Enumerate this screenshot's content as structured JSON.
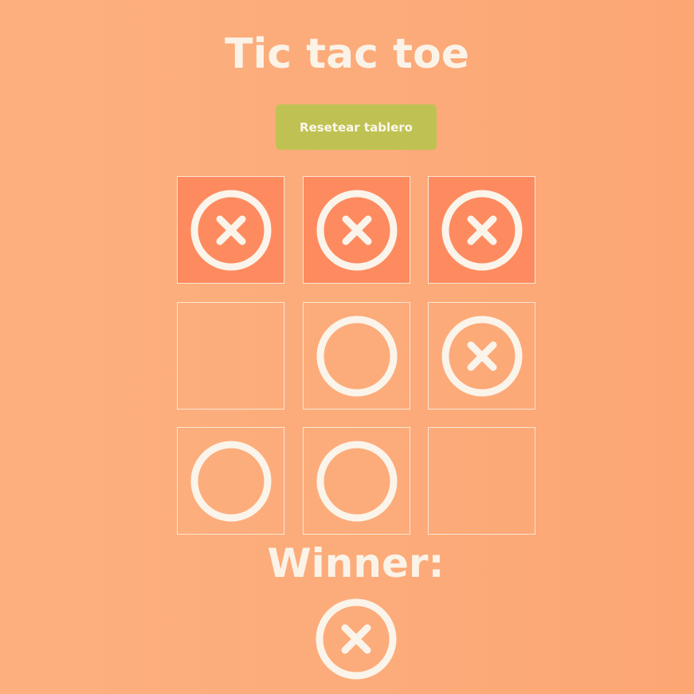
{
  "header": {
    "title": "Tic tac toe",
    "reset_label": "Resetear tablero"
  },
  "board": {
    "cells": [
      "x",
      "x",
      "x",
      "",
      "o",
      "x",
      "o",
      "o",
      ""
    ],
    "winning_cells": [
      0,
      1,
      2
    ]
  },
  "result": {
    "label": "Winner:",
    "winner": "x"
  },
  "colors": {
    "background": "#fdad7a",
    "winning_cell": "#fd8b5f",
    "button": "#bfc252",
    "mark": "#fbf4ea"
  },
  "icons": {
    "x": "circled-x-icon",
    "o": "circle-o-icon"
  }
}
